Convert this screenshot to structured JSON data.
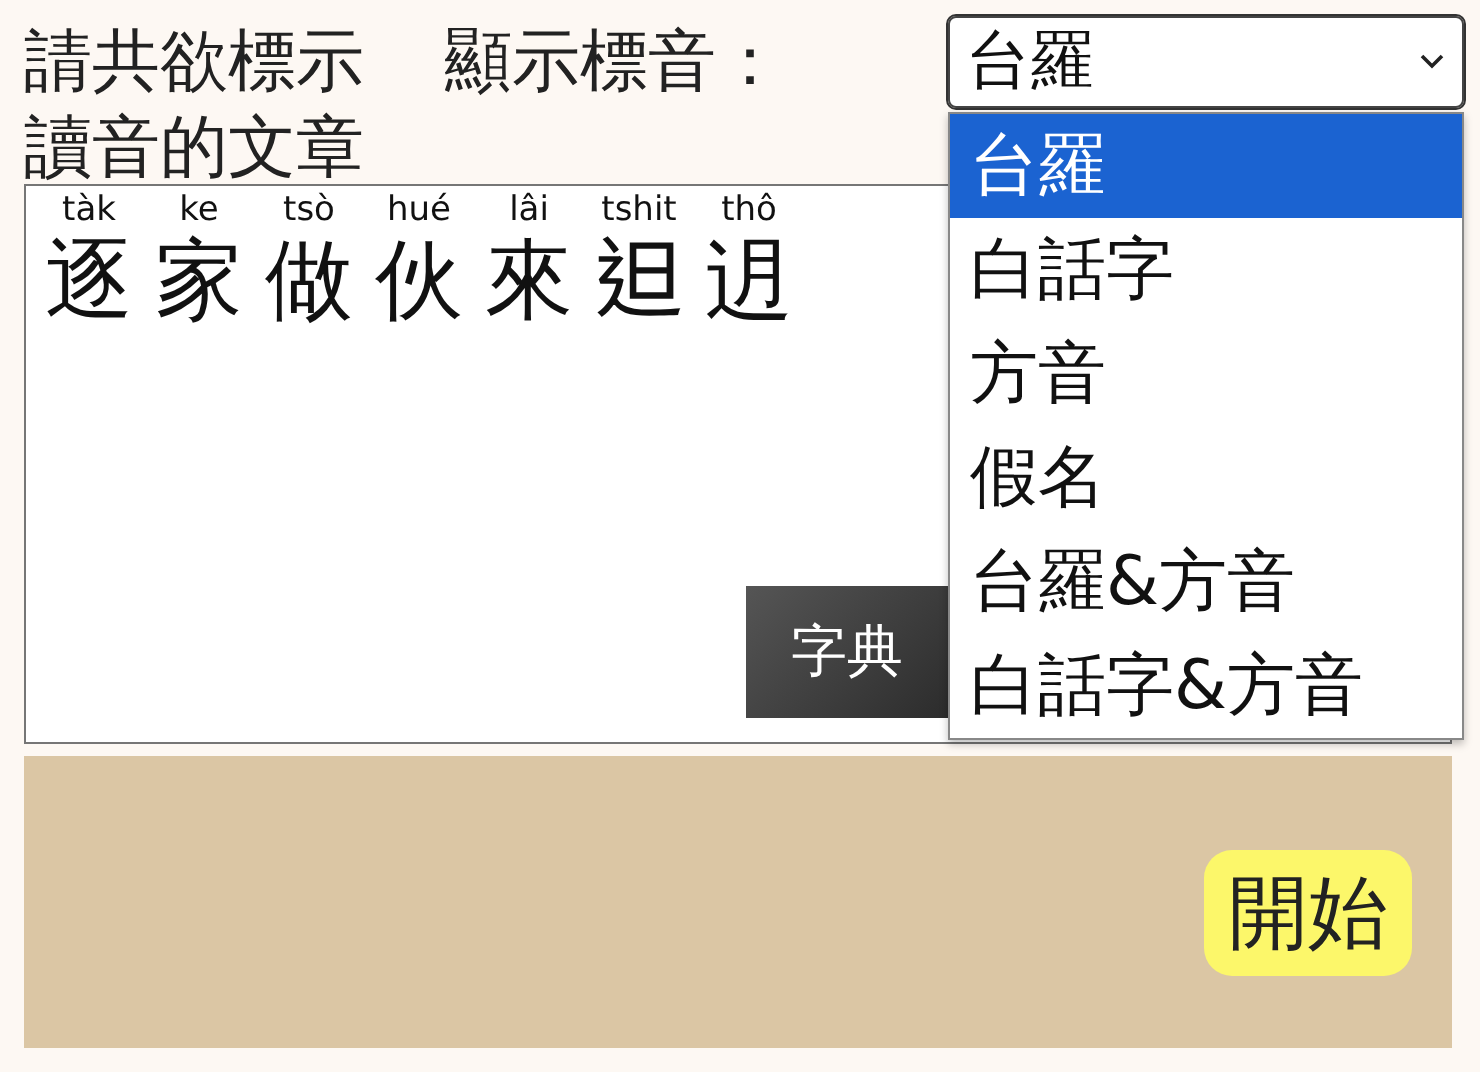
{
  "prompt_lines": [
    "請共欲標示",
    "讀音的文章"
  ],
  "phonetic_select": {
    "label": "顯示標音：",
    "value": "台羅",
    "expanded": true,
    "options": [
      {
        "label": "台羅",
        "selected": true
      },
      {
        "label": "白話字",
        "selected": false
      },
      {
        "label": "方音",
        "selected": false
      },
      {
        "label": "假名",
        "selected": false
      },
      {
        "label": "台羅&方音",
        "selected": false
      },
      {
        "label": "白話字&方音",
        "selected": false
      }
    ]
  },
  "text_area": {
    "characters": [
      {
        "reading": "tàk",
        "char": "逐"
      },
      {
        "reading": "ke",
        "char": "家"
      },
      {
        "reading": "tsò",
        "char": "做"
      },
      {
        "reading": "hué",
        "char": "伙"
      },
      {
        "reading": "lâi",
        "char": "來"
      },
      {
        "reading": "tshit",
        "char": "𨑨"
      },
      {
        "reading": "thô",
        "char": "迌"
      }
    ],
    "dictionary_button": "字典"
  },
  "start_button": "開始"
}
